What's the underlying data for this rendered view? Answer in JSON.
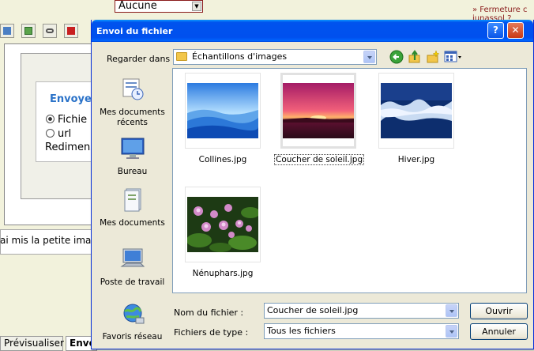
{
  "background": {
    "select_value": "Aucune",
    "link_text": "» Fermeture c",
    "link_text_2": "junassol ?",
    "box_title": "Envoye",
    "radio_file": "Fichie",
    "radio_url": "url",
    "resize_label": "Redimens",
    "body_text": "ai mis la petite ima",
    "tab_preview": "Prévisualiser",
    "tab_send": "Envo"
  },
  "dialog": {
    "title": "Envoi du fichier",
    "help_glyph": "?",
    "close_glyph": "✕",
    "look_in_label": "Regarder dans :",
    "look_in_value": "Échantillons d'images",
    "places": [
      {
        "label": "Mes documents récents",
        "icon": "recent-documents-icon"
      },
      {
        "label": "Bureau",
        "icon": "desktop-icon"
      },
      {
        "label": "Mes documents",
        "icon": "my-documents-icon"
      },
      {
        "label": "Poste de travail",
        "icon": "my-computer-icon"
      },
      {
        "label": "Favoris réseau",
        "icon": "network-places-icon"
      }
    ],
    "files": [
      {
        "name": "Collines.jpg",
        "selected": false
      },
      {
        "name": "Coucher de soleil.jpg",
        "selected": true
      },
      {
        "name": "Hiver.jpg",
        "selected": false
      },
      {
        "name": "Nénuphars.jpg",
        "selected": false
      }
    ],
    "filename_label": "Nom du fichier :",
    "filename_value": "Coucher de soleil.jpg",
    "filetype_label": "Fichiers de type :",
    "filetype_value": "Tous les fichiers",
    "open_button": "Ouvrir",
    "cancel_button": "Annuler"
  }
}
